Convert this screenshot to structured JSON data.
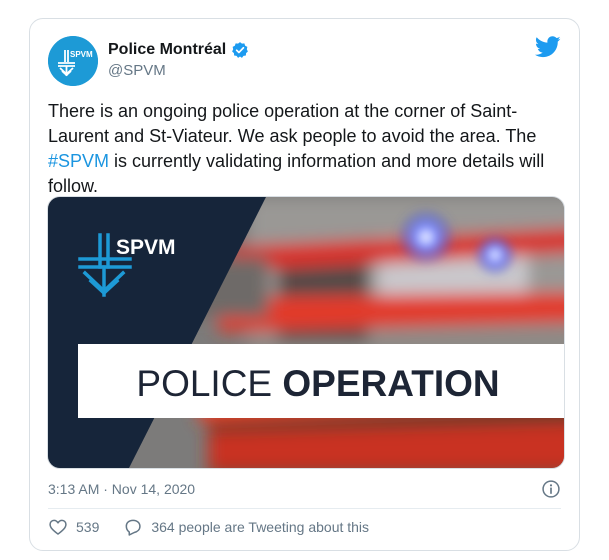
{
  "tweet": {
    "display_name": "Police Montréal",
    "handle": "@SPVM",
    "avatar_text": "SPVM",
    "text_before_hashtag": "There is an ongoing police operation at the corner of Saint-Laurent and St-Viateur. We ask people to avoid the area. The ",
    "hashtag": "#SPVM",
    "text_after_hashtag": " is currently validating information and more details will follow.",
    "timestamp": "3:13 AM · Nov 14, 2020",
    "likes": "539",
    "conversation": "364 people are Tweeting about this"
  },
  "media": {
    "logo_text": "SPVM",
    "banner_light": "POLICE ",
    "banner_bold": "OPERATION"
  },
  "icons": {
    "verified": "verified-badge-icon",
    "twitter": "twitter-bird-icon",
    "info": "info-icon",
    "like": "heart-icon",
    "reply": "speech-bubble-icon"
  },
  "colors": {
    "brand_blue": "#1d9bf0",
    "hashtag": "#1b95e0",
    "navy_panel": "#16253a",
    "text_secondary": "#657786"
  }
}
